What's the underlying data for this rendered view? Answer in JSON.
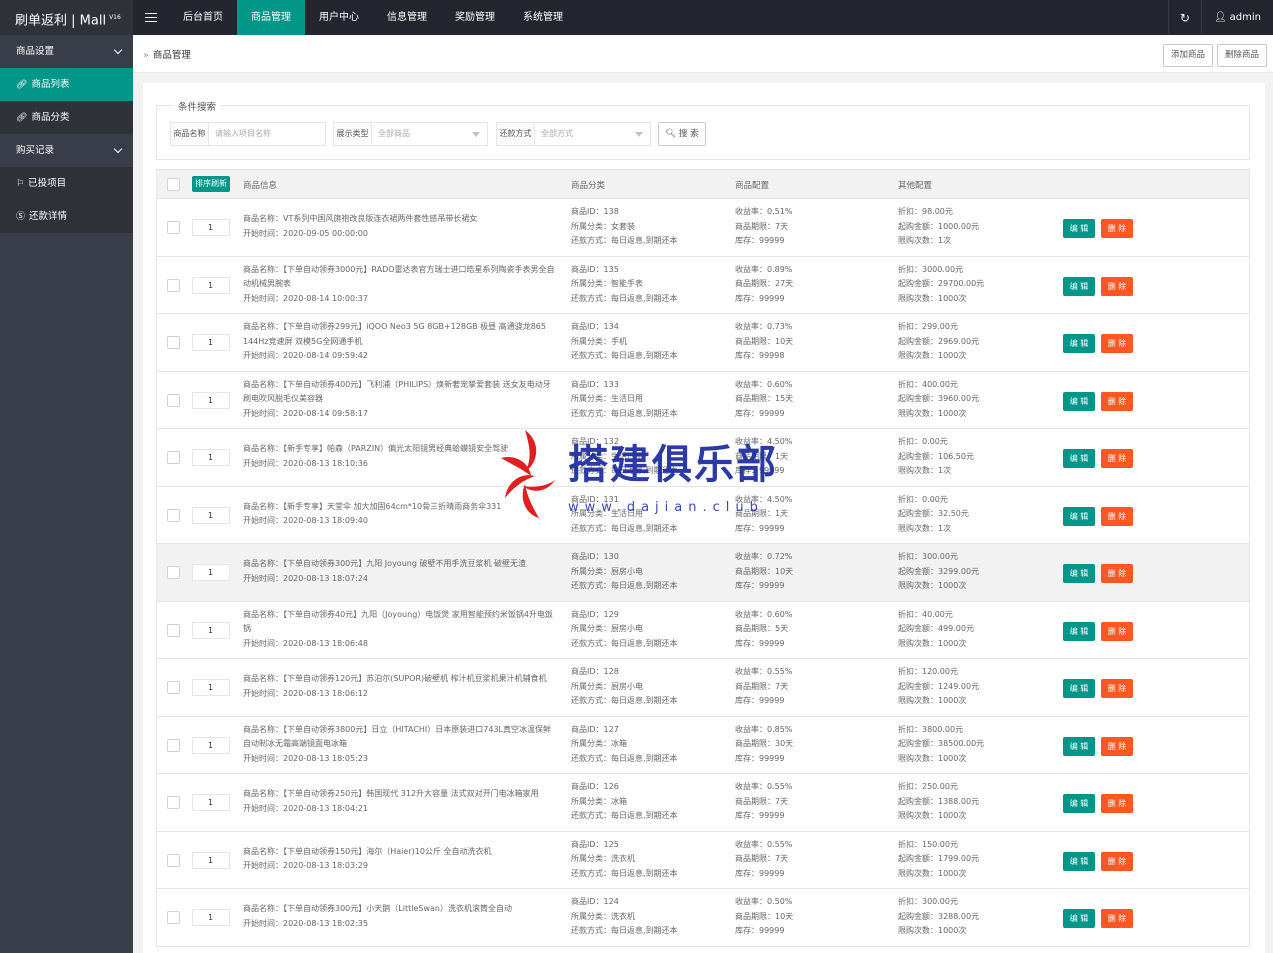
{
  "app": {
    "title": "刷单返利 | Mall",
    "version": "V16"
  },
  "topnav": {
    "items": [
      {
        "label": "后台首页",
        "active": false
      },
      {
        "label": "商品管理",
        "active": true
      },
      {
        "label": "用户中心",
        "active": false
      },
      {
        "label": "信息管理",
        "active": false
      },
      {
        "label": "奖励管理",
        "active": false
      },
      {
        "label": "系统管理",
        "active": false
      }
    ],
    "user": "admin"
  },
  "sidebar": {
    "items": [
      {
        "label": "商品设置",
        "type": "group",
        "icon": "chevron-icon"
      },
      {
        "label": "商品列表",
        "type": "sub-active",
        "icon": "link-icon"
      },
      {
        "label": "商品分类",
        "type": "sub",
        "icon": "link-icon"
      },
      {
        "label": "购买记录",
        "type": "group",
        "icon": "chevron-icon"
      },
      {
        "label": "已投项目",
        "type": "sub",
        "icon": "flag-icon"
      },
      {
        "label": "还款详情",
        "type": "sub",
        "icon": "dollar-icon"
      }
    ]
  },
  "breadcrumb": {
    "label": "商品管理",
    "add_btn": "添加商品",
    "del_btn": "删除商品"
  },
  "search": {
    "legend": "条件搜索",
    "name_label": "商品名称",
    "name_placeholder": "请输入项目名称",
    "type_label": "展示类型",
    "type_value": "全部商品",
    "repay_label": "还款方式",
    "repay_value": "全部方式",
    "button": "搜 索"
  },
  "table": {
    "sort_btn": "排序刷新",
    "headers": {
      "info": "商品信息",
      "cat": "商品分类",
      "cfg": "商品配置",
      "other": "其他配置"
    },
    "edit_label": "编 辑",
    "del_label": "删 除",
    "rows": [
      {
        "order": "1",
        "name": "商品名称：VT系列中国风旗袍改良版连衣裙两件套性感吊带长裙女",
        "start": "开始时间：2020-09-05 00:00:00",
        "id": "商品ID：138",
        "cat": "所属分类：女套装",
        "repay": "还款方式：每日返息,到期还本",
        "rate": "收益率：0.51%",
        "term": "商品期限：7天",
        "stock": "库存：99999",
        "price": "折扣：98.00元",
        "min": "起购金额：1000.00元",
        "limit": "限购次数：1次",
        "hl": false
      },
      {
        "order": "1",
        "name": "商品名称：【下单自动领券3000元】RADO雷达表官方瑞士进口皓星系列陶瓷手表男全自动机械男腕表",
        "start": "开始时间：2020-08-14 10:00:37",
        "id": "商品ID：135",
        "cat": "所属分类：智能手表",
        "repay": "还款方式：每日返息,到期还本",
        "rate": "收益率：0.89%",
        "term": "商品期限：27天",
        "stock": "库存：99999",
        "price": "折扣：3000.00元",
        "min": "起购金额：29700.00元",
        "limit": "限购次数：1000次",
        "hl": false
      },
      {
        "order": "1",
        "name": "商品名称：【下单自动领券299元】iQOO Neo3 5G 8GB+128GB 极昼 高通骁龙865 144Hz竞速屏 双模5G全网通手机",
        "start": "开始时间：2020-08-14 09:59:42",
        "id": "商品ID：134",
        "cat": "所属分类：手机",
        "repay": "还款方式：每日返息,到期还本",
        "rate": "收益率：0.73%",
        "term": "商品期限：10天",
        "stock": "库存：99998",
        "price": "折扣：299.00元",
        "min": "起购金额：2969.00元",
        "limit": "限购次数：1000次",
        "hl": false
      },
      {
        "order": "1",
        "name": "商品名称：【下单自动领券400元】飞利浦（PHILIPS）焕新奢宠挚爱套装 送女友电动牙刷电吹风脱毛仪美容器",
        "start": "开始时间：2020-08-14 09:58:17",
        "id": "商品ID：133",
        "cat": "所属分类：生活日用",
        "repay": "还款方式：每日返息,到期还本",
        "rate": "收益率：0.60%",
        "term": "商品期限：15天",
        "stock": "库存：99999",
        "price": "折扣：400.00元",
        "min": "起购金额：3960.00元",
        "limit": "限购次数：1000次",
        "hl": false
      },
      {
        "order": "1",
        "name": "商品名称：【新手专享】帕森（PARZIN）偏光太阳镜男经典蛤蟆镜安全驾驶",
        "start": "开始时间：2020-08-13 18:10:36",
        "id": "商品ID：132",
        "cat": "所属分类：生活日用",
        "repay": "还款方式：每日返息,到期还本",
        "rate": "收益率：4.50%",
        "term": "商品期限：1天",
        "stock": "库存：99999",
        "price": "折扣：0.00元",
        "min": "起购金额：106.50元",
        "limit": "限购次数：1次",
        "hl": false
      },
      {
        "order": "1",
        "name": "商品名称：【新手专享】天堂伞 加大加固64cm*10骨三折晴雨商务伞331",
        "start": "开始时间：2020-08-13 18:09:40",
        "id": "商品ID：131",
        "cat": "所属分类：生活日用",
        "repay": "还款方式：每日返息,到期还本",
        "rate": "收益率：4.50%",
        "term": "商品期限：1天",
        "stock": "库存：99999",
        "price": "折扣：0.00元",
        "min": "起购金额：32.50元",
        "limit": "限购次数：1次",
        "hl": false
      },
      {
        "order": "1",
        "name": "商品名称：【下单自动领券300元】九阳 Joyoung 破壁不用手洗豆浆机 破壁无渣",
        "start": "开始时间：2020-08-13 18:07:24",
        "id": "商品ID：130",
        "cat": "所属分类：厨房小电",
        "repay": "还款方式：每日返息,到期还本",
        "rate": "收益率：0.72%",
        "term": "商品期限：10天",
        "stock": "库存：99999",
        "price": "折扣：300.00元",
        "min": "起购金额：3299.00元",
        "limit": "限购次数：1000次",
        "hl": true
      },
      {
        "order": "1",
        "name": "商品名称：【下单自动领券40元】九阳（Joyoung）电饭煲 家用智能预约米饭锅4升电饭锅",
        "start": "开始时间：2020-08-13 18:06:48",
        "id": "商品ID：129",
        "cat": "所属分类：厨房小电",
        "repay": "还款方式：每日返息,到期还本",
        "rate": "收益率：0.60%",
        "term": "商品期限：5天",
        "stock": "库存：99999",
        "price": "折扣：40.00元",
        "min": "起购金额：499.00元",
        "limit": "限购次数：1000次",
        "hl": false
      },
      {
        "order": "1",
        "name": "商品名称：【下单自动领券120元】苏泊尔(SUPOR)破壁机 榨汁机豆浆机果汁机辅食机",
        "start": "开始时间：2020-08-13 18:06:12",
        "id": "商品ID：128",
        "cat": "所属分类：厨房小电",
        "repay": "还款方式：每日返息,到期还本",
        "rate": "收益率：0.55%",
        "term": "商品期限：7天",
        "stock": "库存：99999",
        "price": "折扣：120.00元",
        "min": "起购金额：1249.00元",
        "limit": "限购次数：1000次",
        "hl": false
      },
      {
        "order": "1",
        "name": "商品名称：【下单自动领券3800元】日立（HITACHI）日本原装进口743L真空冰温保鲜自动制冰无霜高端镜面电冰箱",
        "start": "开始时间：2020-08-13 18:05:23",
        "id": "商品ID：127",
        "cat": "所属分类：冰箱",
        "repay": "还款方式：每日返息,到期还本",
        "rate": "收益率：0.85%",
        "term": "商品期限：30天",
        "stock": "库存：99999",
        "price": "折扣：3800.00元",
        "min": "起购金额：38500.00元",
        "limit": "限购次数：1000次",
        "hl": false
      },
      {
        "order": "1",
        "name": "商品名称：【下单自动领券250元】韩国现代 312升大容量 法式双对开门电冰箱家用",
        "start": "开始时间：2020-08-13 18:04:21",
        "id": "商品ID：126",
        "cat": "所属分类：冰箱",
        "repay": "还款方式：每日返息,到期还本",
        "rate": "收益率：0.55%",
        "term": "商品期限：7天",
        "stock": "库存：99999",
        "price": "折扣：250.00元",
        "min": "起购金额：1388.00元",
        "limit": "限购次数：1000次",
        "hl": false
      },
      {
        "order": "1",
        "name": "商品名称：【下单自动领券150元】海尔（Haier)10公斤 全自动洗衣机",
        "start": "开始时间：2020-08-13 18:03:29",
        "id": "商品ID：125",
        "cat": "所属分类：洗衣机",
        "repay": "还款方式：每日返息,到期还本",
        "rate": "收益率：0.55%",
        "term": "商品期限：7天",
        "stock": "库存：99999",
        "price": "折扣：150.00元",
        "min": "起购金额：1799.00元",
        "limit": "限购次数：1000次",
        "hl": false
      },
      {
        "order": "1",
        "name": "商品名称：【下单自动领券300元】小天鹅（LittleSwan）洗衣机滚筒全自动",
        "start": "开始时间：2020-08-13 18:02:35",
        "id": "商品ID：124",
        "cat": "所属分类：洗衣机",
        "repay": "还款方式：每日返息,到期还本",
        "rate": "收益率：0.50%",
        "term": "商品期限：10天",
        "stock": "库存：99999",
        "price": "折扣：300.00元",
        "min": "起购金额：3288.00元",
        "limit": "限购次数：1000次",
        "hl": false
      }
    ]
  },
  "watermark": {
    "text": "搭建俱乐部",
    "url": "www.dajian.club"
  }
}
